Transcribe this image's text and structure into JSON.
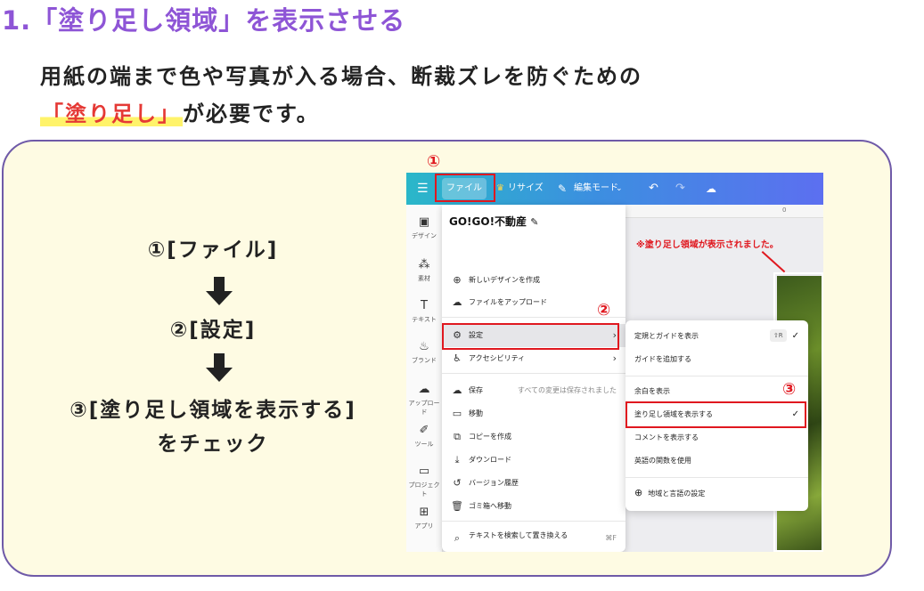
{
  "heading": "1.「塗り足し領域」を表示させる",
  "intro": {
    "line1": "用紙の端まで色や写真が入る場合、断裁ズレを防ぐための",
    "highlight": "「塗り足し」",
    "line2_rest": "が必要です。"
  },
  "steps": {
    "step1": "①[ファイル]",
    "step2": "②[設定]",
    "step3_line1": "③[塗り足し領域を表示する]",
    "step3_line2": "をチェック"
  },
  "markers": {
    "m1": "①",
    "m2": "②",
    "m3": "③"
  },
  "app": {
    "topbar": {
      "menu_icon": "hamburger-icon",
      "file": "ファイル",
      "resize": "リサイズ",
      "edit_mode": "編集モード",
      "undo_icon": "undo-icon",
      "redo_icon": "redo-icon",
      "cloud_icon": "cloud-check-icon"
    },
    "sidebar": [
      {
        "label": "デザイン",
        "icon": "layout-icon"
      },
      {
        "label": "素材",
        "icon": "elements-icon"
      },
      {
        "label": "テキスト",
        "icon": "text-icon"
      },
      {
        "label": "ブランド",
        "icon": "brand-icon"
      },
      {
        "label": "アップロード",
        "icon": "upload-icon"
      },
      {
        "label": "ツール",
        "icon": "draw-icon"
      },
      {
        "label": "プロジェクト",
        "icon": "folder-icon"
      },
      {
        "label": "アプリ",
        "icon": "apps-icon"
      }
    ],
    "ruler_zero": "0",
    "note": "※塗り足し領域が表示されました。",
    "menu": {
      "title": "GO!GO!不動産",
      "items": [
        {
          "label": "新しいデザインを作成",
          "icon": "new-design-icon"
        },
        {
          "label": "ファイルをアップロード",
          "icon": "upload-icon"
        },
        {
          "label": "設定",
          "icon": "gear-icon"
        },
        {
          "label": "アクセシビリティ",
          "icon": "accessibility-icon"
        },
        {
          "label": "保存",
          "icon": "cloud-check-icon",
          "extra": "すべての変更は保存されました"
        },
        {
          "label": "移動",
          "icon": "folder-icon"
        },
        {
          "label": "コピーを作成",
          "icon": "copy-icon"
        },
        {
          "label": "ダウンロード",
          "icon": "download-icon"
        },
        {
          "label": "バージョン履歴",
          "icon": "history-icon"
        },
        {
          "label": "ゴミ箱へ移動",
          "icon": "trash-icon"
        },
        {
          "label": "テキストを検索して置き換える",
          "icon": "search-icon",
          "extra": "⌘F"
        }
      ]
    },
    "submenu": {
      "items": [
        {
          "label": "定規とガイドを表示",
          "shortcut": "⇧R",
          "checked": true
        },
        {
          "label": "ガイドを追加する"
        },
        {
          "label": "余白を表示"
        },
        {
          "label": "塗り足し領域を表示する",
          "checked": true
        },
        {
          "label": "コメントを表示する"
        },
        {
          "label": "英語の関数を使用"
        },
        {
          "label": "地域と言語の設定",
          "icon": "globe-icon"
        }
      ]
    }
  }
}
